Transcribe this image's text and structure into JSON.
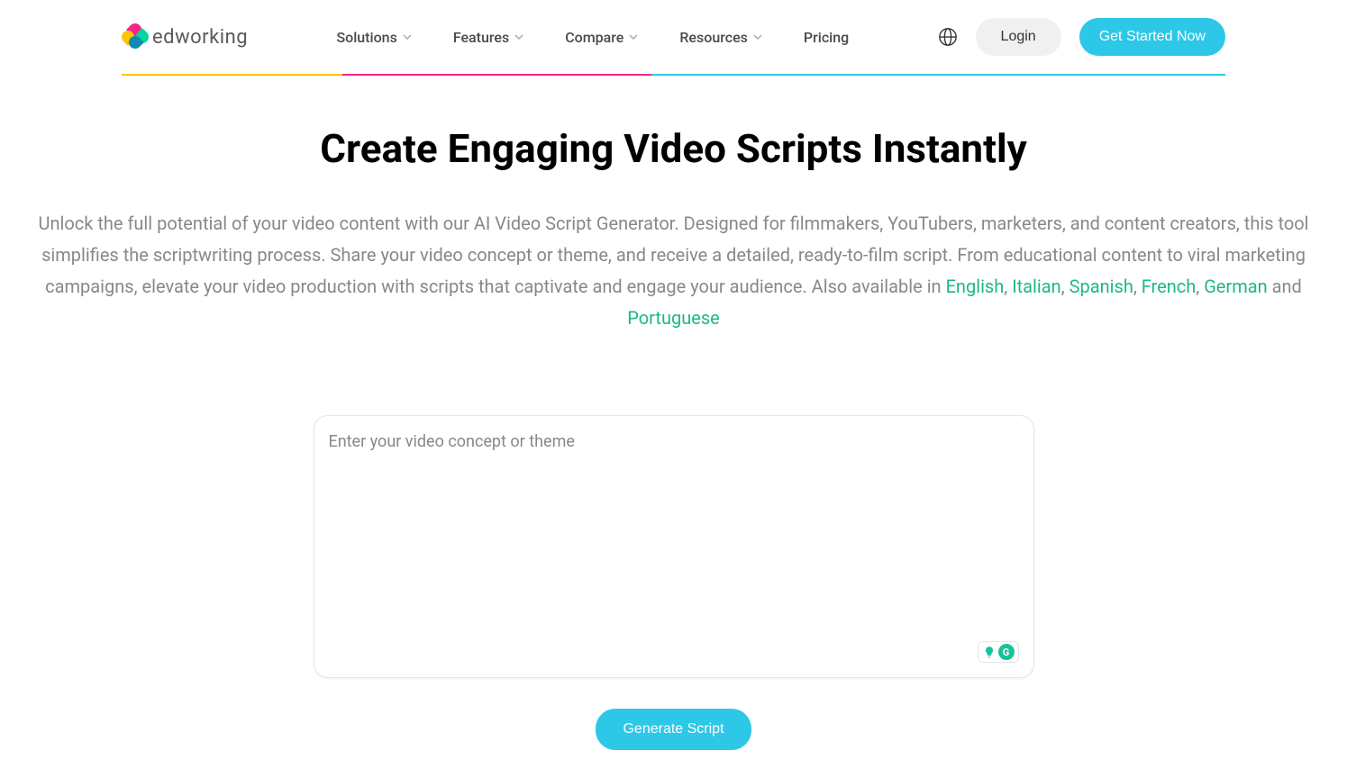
{
  "logo": {
    "text": "edworking"
  },
  "nav": {
    "items": [
      {
        "label": "Solutions",
        "hasDropdown": true
      },
      {
        "label": "Features",
        "hasDropdown": true
      },
      {
        "label": "Compare",
        "hasDropdown": true
      },
      {
        "label": "Resources",
        "hasDropdown": true
      },
      {
        "label": "Pricing",
        "hasDropdown": false
      }
    ]
  },
  "header": {
    "login": "Login",
    "cta": "Get Started Now"
  },
  "hero": {
    "title": "Create Engaging Video Scripts Instantly",
    "desc_part1": "Unlock the full potential of your video content with our AI Video Script Generator. Designed for filmmakers, YouTubers, marketers, and content creators, this tool simplifies the scriptwriting process. Share your video concept or theme, and receive a detailed, ready-to-film script. From educational content to viral marketing campaigns, elevate your video production with scripts that captivate and engage your audience. Also available in ",
    "desc_and": " and ",
    "languages": [
      "English",
      "Italian",
      "Spanish",
      "French",
      "German",
      "Portuguese"
    ]
  },
  "input": {
    "placeholder": "Enter your video concept or theme",
    "generate_label": "Generate Script"
  }
}
